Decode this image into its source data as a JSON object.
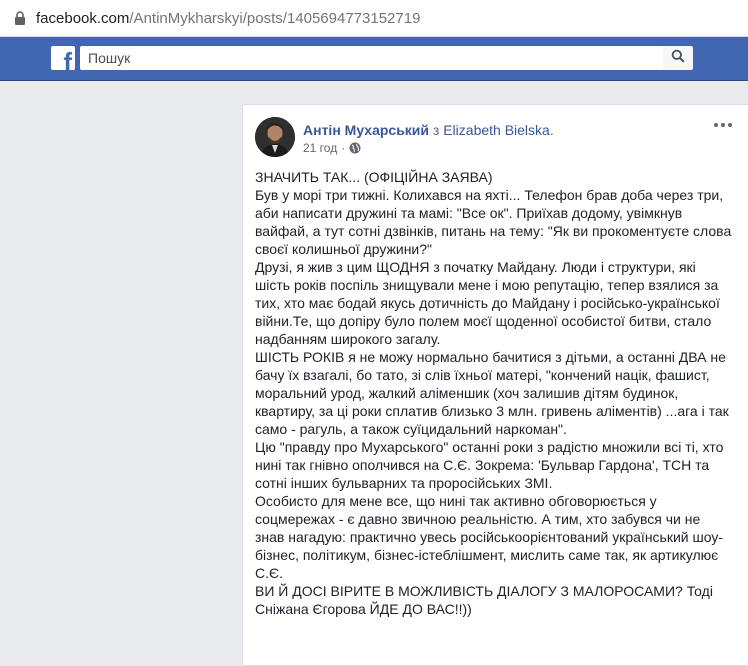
{
  "browser": {
    "url_domain": "facebook.com",
    "url_path": "/AntinMykharskyi/posts/1405694773152719"
  },
  "header": {
    "logo_letter": "f",
    "search_placeholder": "Пошук"
  },
  "post": {
    "author": "Антін Мухарський",
    "with_word": "з",
    "with_name": "Elizabeth Bielska",
    "with_suffix": ".",
    "time": "21 год",
    "dot": "·",
    "privacy_icon": "globe-icon",
    "paragraphs": [
      "ЗНАЧИТЬ ТАК... (ОФІЦІЙНА ЗАЯВА)",
      "Був у морі три тижні. Колихався на яхті... Телефон брав доба через три, аби написати дружині та мамі: \"Все ок\". Приїхав додому, увімкнув вайфай, а тут сотні дзвінків, питань на тему: \"Як ви прокоментуєте слова своєї колишньої дружини?\"",
      "Друзі, я жив з цим ЩОДНЯ з початку Майдану. Люди і структури, які шість років поспіль знищували мене і мою репутацію, тепер взялися за тих, хто має бодай якусь дотичність до Майдану і російсько-української війни.Те, що допіру було полем моєї щоденної особистої битви, стало надбанням широкого загалу.",
      "ШІСТЬ РОКІВ я не можу нормально бачитися з дітьми, а останні ДВА не бачу їх взагалі, бо тато, зі слів їхньої матері, \"кончений націк, фашист, моральний урод, жалкий аліменшик (хоч залишив дітям будинок, квартиру, за ці роки сплатив близько 3 млн. гривень аліментів) ...ага і так само - рагуль, а також суїцидальний наркоман\".",
      "Цю \"правду про Мухарського\" останні роки з радістю множили всі ті, хто нині так гнівно ополчився на С.Є. Зокрема: 'Бульвар Гардона', ТСН та сотні інших бульварних та проросійських ЗМІ.",
      "Особисто для мене все, що нині так активно обговорюється у соцмережах - є давно звичною реальністю. А тим, хто забувся чи не знав нагадую: практично увесь російськоорієнтований український шоу-бізнес, політикум, бізнес-істеблішмент, мислить саме так, як артикулює С.Є.",
      "ВИ Й ДОСІ ВІРИТЕ В МОЖЛИВІСТЬ ДІАЛОГУ З МАЛОРОСАМИ? Тоді Сніжана Єгорова ЙДЕ ДО ВАС!!))"
    ]
  }
}
